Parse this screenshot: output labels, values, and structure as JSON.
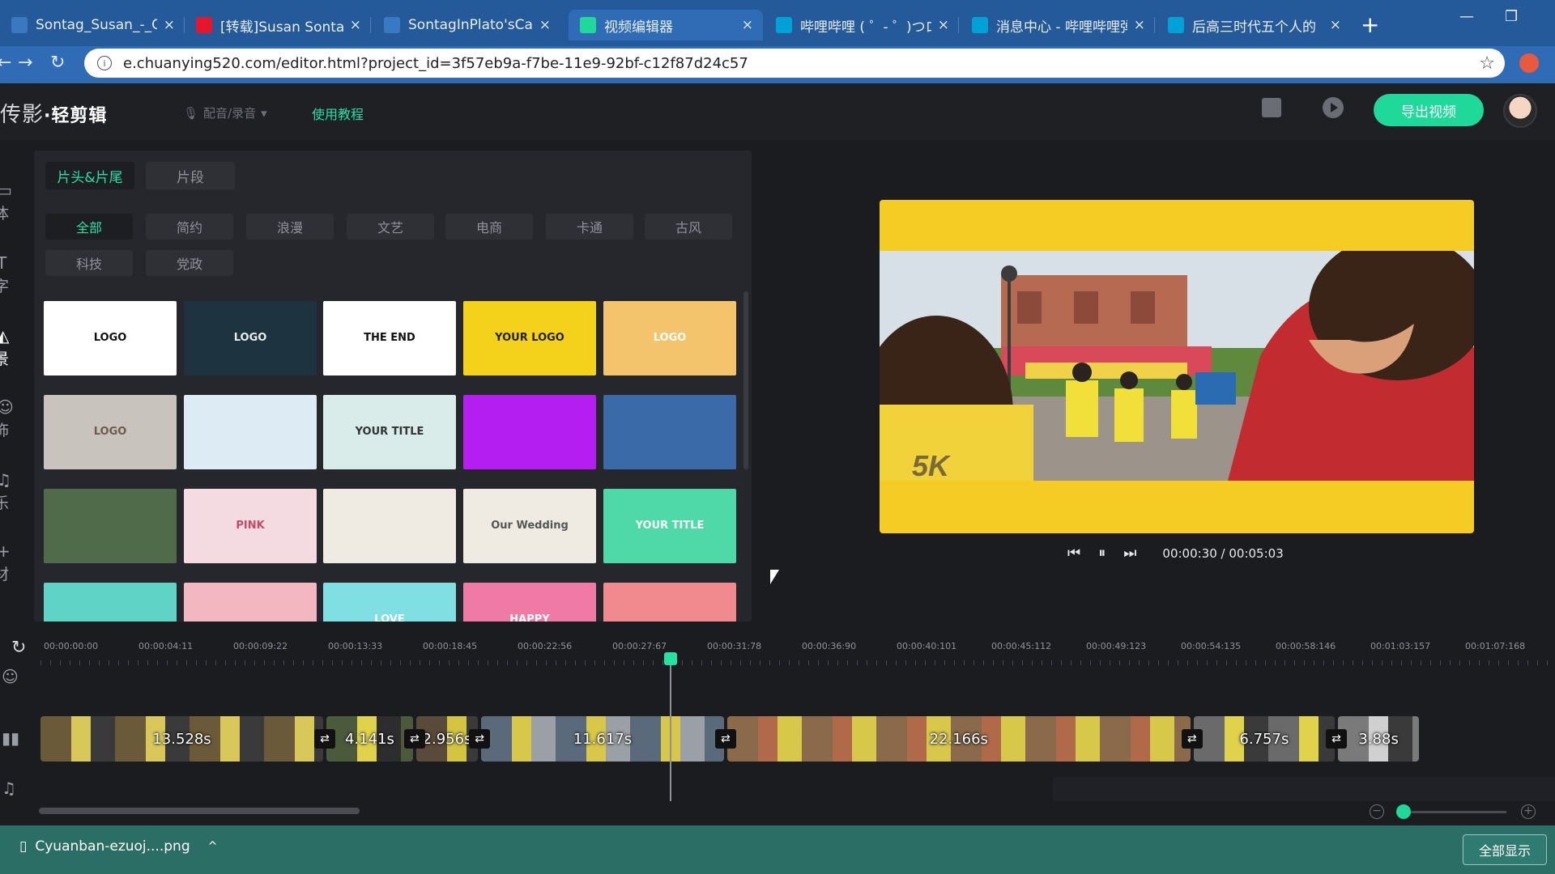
{
  "browser": {
    "tabs": [
      {
        "title": "Sontag_Susan_-_On",
        "favicon": "doc-icon",
        "color": "#3a78c2"
      },
      {
        "title": "[转载]Susan Sontag",
        "favicon": "weibo-icon",
        "color": "#e6162d"
      },
      {
        "title": "SontagInPlato'sCave",
        "favicon": "doc-icon",
        "color": "#3a78c2"
      },
      {
        "title": "视频编辑器",
        "favicon": "chuanying-icon",
        "color": "#1fd99a",
        "active": true
      },
      {
        "title": "哔哩哔哩 ( ゜- ゜)つロ",
        "favicon": "bilibili-icon",
        "color": "#00a1d6"
      },
      {
        "title": "消息中心 - 哔哩哔哩弹",
        "favicon": "bilibili-icon",
        "color": "#00a1d6"
      },
      {
        "title": "后高三时代五个人的",
        "favicon": "bilibili-icon",
        "color": "#00a1d6"
      }
    ],
    "close_glyph": "×",
    "new_tab_glyph": "+",
    "url": "e.chuanying520.com/editor.html?project_id=3f57eb9a-f7be-11e9-92bf-c12f87d24c57"
  },
  "app": {
    "brand_main": "传影",
    "brand_sub": "·轻剪辑",
    "mic_label": "配音/录音",
    "tutorial_label": "使用教程",
    "export_label": "导出视频",
    "accent": "#1fd99a"
  },
  "sidebar": {
    "items": [
      {
        "label": "体",
        "icon": "media-icon"
      },
      {
        "label": "字",
        "icon": "text-icon"
      },
      {
        "label": "景",
        "icon": "scene-icon",
        "active": true
      },
      {
        "label": "饰",
        "icon": "sticker-icon"
      },
      {
        "label": "乐",
        "icon": "music-icon"
      },
      {
        "label": "材",
        "icon": "add-material-icon"
      }
    ]
  },
  "panel": {
    "subtabs": [
      {
        "label": "片头&片尾",
        "active": true
      },
      {
        "label": "片段"
      }
    ],
    "categories": [
      {
        "label": "全部",
        "active": true
      },
      {
        "label": "简约"
      },
      {
        "label": "浪漫"
      },
      {
        "label": "文艺"
      },
      {
        "label": "电商"
      },
      {
        "label": "卡通"
      },
      {
        "label": "古风"
      },
      {
        "label": "科技"
      },
      {
        "label": "党政"
      }
    ],
    "thumbs": [
      {
        "text": "LOGO",
        "bg": "#ffffff",
        "fg": "#111"
      },
      {
        "text": "LOGO",
        "bg": "#1e3340",
        "fg": "#e6eef2"
      },
      {
        "text": "THE END",
        "bg": "#ffffff",
        "fg": "#111"
      },
      {
        "text": "YOUR LOGO",
        "bg": "#f4d21c",
        "fg": "#222"
      },
      {
        "text": "LOGO",
        "bg": "#f3c46b",
        "fg": "#fff"
      },
      {
        "text": "LOGO",
        "bg": "#c9c3bd",
        "fg": "#6b5c4f"
      },
      {
        "text": "",
        "bg": "#dcebf4",
        "fg": "#7aa5c4"
      },
      {
        "text": "YOUR TITLE",
        "bg": "#d9ecea",
        "fg": "#333"
      },
      {
        "text": "",
        "bg": "#b51ef0",
        "fg": "#fff"
      },
      {
        "text": "",
        "bg": "#3b6aa8",
        "fg": "#fff"
      },
      {
        "text": "",
        "bg": "#4f6b4a",
        "fg": "#fff"
      },
      {
        "text": "PINK",
        "bg": "#f4dbe1",
        "fg": "#c24b6c"
      },
      {
        "text": "",
        "bg": "#efeae2",
        "fg": "#a06a5a"
      },
      {
        "text": "Our Wedding",
        "bg": "#efeae2",
        "fg": "#555"
      },
      {
        "text": "YOUR TITLE",
        "bg": "#4fd8a8",
        "fg": "#fff"
      },
      {
        "text": "",
        "bg": "#5ed3c6",
        "fg": "#fff"
      },
      {
        "text": "",
        "bg": "#f2b7c1",
        "fg": "#fff"
      },
      {
        "text": "LOVE",
        "bg": "#7fdfe3",
        "fg": "#fff"
      },
      {
        "text": "HAPPY",
        "bg": "#f07aa6",
        "fg": "#fff"
      },
      {
        "text": "",
        "bg": "#f08a8f",
        "fg": "#fff"
      }
    ]
  },
  "player": {
    "timecode": "00:00:30 / 00:05:03",
    "prev_icon": "skip-back-icon",
    "pause_icon": "pause-icon",
    "next_icon": "skip-forward-icon"
  },
  "timeline": {
    "ruler": [
      "00:00:00:00",
      "00:00:04:11",
      "00:00:09:22",
      "00:00:13:33",
      "00:00:18:45",
      "00:00:22:56",
      "00:00:27:67",
      "00:00:31:78",
      "00:00:36:90",
      "00:00:40:101",
      "00:00:45:112",
      "00:00:49:123",
      "00:00:54:135",
      "00:00:58:146",
      "00:01:03:157",
      "00:01:07:168"
    ],
    "clips": [
      {
        "dur": "13.528s",
        "seconds": 13.528
      },
      {
        "dur": "4.141s",
        "seconds": 4.141
      },
      {
        "dur": "2.956s",
        "seconds": 2.956
      },
      {
        "dur": "11.617s",
        "seconds": 11.617
      },
      {
        "dur": "22.166s",
        "seconds": 22.166
      },
      {
        "dur": "6.757s",
        "seconds": 6.757
      },
      {
        "dur": "3.88s",
        "seconds": 3.88
      }
    ],
    "transition_glyph": "⇄"
  },
  "download": {
    "file_name": "Cyuanban-ezuoj....png",
    "show_all_label": "全部显示"
  }
}
